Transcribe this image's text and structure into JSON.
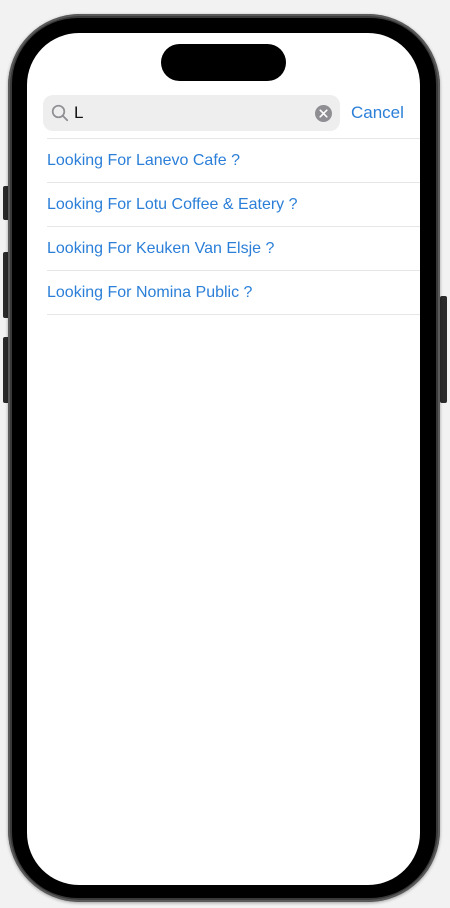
{
  "search": {
    "query": "L",
    "cancel_label": "Cancel"
  },
  "suggestions": [
    {
      "label": "Looking For Lanevo Cafe ?"
    },
    {
      "label": "Looking For Lotu Coffee & Eatery ?"
    },
    {
      "label": "Looking For Keuken Van Elsje ?"
    },
    {
      "label": "Looking For Nomina Public ?"
    }
  ],
  "colors": {
    "accent": "#2b7fd8",
    "search_field_bg": "#eeeeef",
    "divider": "#e6e6e6"
  },
  "icons": {
    "search": "search-icon",
    "clear": "clear-icon"
  }
}
